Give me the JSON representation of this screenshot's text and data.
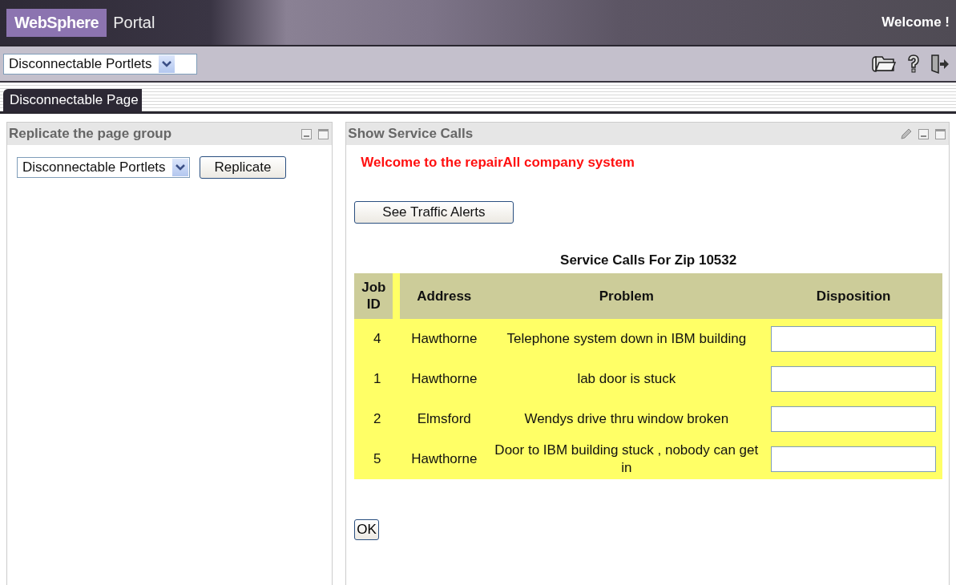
{
  "banner": {
    "brand": "WebSphere",
    "product": "Portal",
    "greeting": "Welcome !"
  },
  "toolbar": {
    "page_select": "Disconnectable Portlets"
  },
  "tabs": [
    {
      "label": "Disconnectable Page",
      "selected": true
    }
  ],
  "left_portlet": {
    "title": "Replicate the page group",
    "select": "Disconnectable Portlets",
    "button": "Replicate"
  },
  "right_portlet": {
    "title": "Show Service Calls",
    "welcome": "Welcome to the repairAll company system",
    "traffic_button": "See Traffic Alerts",
    "table_title": "Service Calls For Zip 10532",
    "columns": [
      "Job ID",
      "Address",
      "Problem",
      "Disposition"
    ],
    "rows": [
      {
        "job_id": "4",
        "address": "Hawthorne",
        "problem": "Telephone system down in IBM building"
      },
      {
        "job_id": "1",
        "address": "Hawthorne",
        "problem": "lab door is stuck"
      },
      {
        "job_id": "2",
        "address": "Elmsford",
        "problem": "Wendys drive thru window broken"
      },
      {
        "job_id": "5",
        "address": "Hawthorne",
        "problem": "Door to IBM building stuck , nobody can get in"
      }
    ],
    "ok_button": "OK"
  }
}
